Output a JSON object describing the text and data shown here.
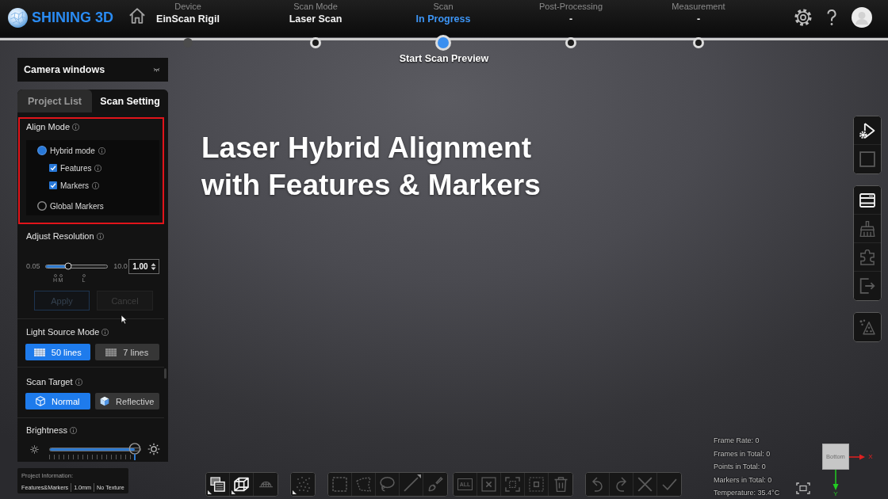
{
  "header": {
    "brand": "SHINING 3D"
  },
  "steps": [
    {
      "label": "Device",
      "value": "EinScan Rigil",
      "current": false,
      "disabled": true
    },
    {
      "label": "Scan Mode",
      "value": "Laser Scan",
      "current": false,
      "disabled": false
    },
    {
      "label": "Scan",
      "value": "In Progress",
      "current": true,
      "disabled": false
    },
    {
      "label": "Post-Processing",
      "value": "-",
      "current": false,
      "disabled": false
    },
    {
      "label": "Measurement",
      "value": "-",
      "current": false,
      "disabled": false
    }
  ],
  "step_caption": "Start Scan Preview",
  "camera_windows": {
    "title": "Camera windows"
  },
  "panel": {
    "tabs": [
      {
        "label": "Project List",
        "selected": false
      },
      {
        "label": "Scan Setting",
        "selected": true
      }
    ],
    "align_mode": {
      "title": "Align Mode",
      "info": true,
      "highlighted": true,
      "options": [
        {
          "label": "Hybrid mode",
          "info": true,
          "selected": true,
          "children": [
            {
              "label": "Features",
              "info": true,
              "checked": true
            },
            {
              "label": "Markers",
              "info": true,
              "checked": true
            }
          ]
        },
        {
          "label": "Global Markers",
          "info": false,
          "selected": false
        }
      ]
    },
    "adjust_resolution": {
      "title": "Adjust Resolution",
      "info": true,
      "min_label": "0.05",
      "max_label": "10.0",
      "level": 0.36,
      "value": "1.00",
      "marks": [
        "H",
        "M",
        "L"
      ],
      "buttons": [
        {
          "label": "Apply",
          "disabled": true
        },
        {
          "label": "Cancel",
          "disabled": true
        }
      ]
    },
    "light_source_mode": {
      "title": "Light Source Mode",
      "info": true,
      "options": [
        {
          "label": "50 lines",
          "selected": true
        },
        {
          "label": "7 lines",
          "selected": false
        }
      ]
    },
    "scan_target": {
      "title": "Scan Target",
      "info": true,
      "options": [
        {
          "label": "Normal",
          "kind": "matte",
          "selected": true
        },
        {
          "label": "Reflective",
          "kind": "shiny",
          "selected": false
        }
      ]
    },
    "brightness": {
      "title": "Brightness",
      "info": true,
      "level": 0.94
    }
  },
  "project_information": {
    "title": "Project Information:",
    "items": [
      "Features&Markers",
      "1.0mm",
      "No Texture"
    ]
  },
  "caption": "Laser Hybrid Alignment\nwith Features & Markers",
  "right_toolbar": [
    [
      {
        "kind": "scan",
        "disabled": false
      },
      {
        "kind": "stop",
        "disabled": true
      }
    ],
    [
      {
        "kind": "window",
        "disabled": false
      },
      {
        "kind": "clean",
        "disabled": true
      },
      {
        "kind": "merge",
        "disabled": true
      },
      {
        "kind": "export",
        "disabled": true
      }
    ],
    [
      {
        "kind": "mesh",
        "disabled": true
      }
    ]
  ],
  "bottom_toolbar": [
    [
      {
        "kind": "layers",
        "disabled": false,
        "menu": true
      },
      {
        "kind": "cube",
        "disabled": false,
        "menu": true
      },
      {
        "kind": "dome",
        "disabled": true
      }
    ],
    [
      {
        "kind": "points",
        "disabled": true,
        "menu": true
      }
    ],
    [
      {
        "kind": "rect",
        "disabled": true
      },
      {
        "kind": "polygon",
        "disabled": true
      },
      {
        "kind": "lasso",
        "disabled": true
      },
      {
        "kind": "line",
        "disabled": true,
        "options": true
      },
      {
        "kind": "brush",
        "disabled": true
      }
    ],
    [
      {
        "kind": "all",
        "label": "ALL",
        "disabled": true
      },
      {
        "kind": "deselect",
        "disabled": true
      },
      {
        "kind": "frame",
        "disabled": true
      },
      {
        "kind": "nested",
        "disabled": true
      },
      {
        "kind": "trash",
        "disabled": true
      }
    ],
    [
      {
        "kind": "undo",
        "disabled": true
      },
      {
        "kind": "redo",
        "disabled": true
      },
      {
        "kind": "cancel",
        "disabled": true
      },
      {
        "kind": "confirm",
        "disabled": true
      }
    ]
  ],
  "stats": [
    "Frame Rate: 0",
    "Frames in Total: 0",
    "Points in Total: 0",
    "Markers in Total: 0",
    "Temperature: 35.4°C"
  ],
  "view_cube": {
    "face": "Bottom",
    "x_axis": "X",
    "y_axis": "Y"
  }
}
